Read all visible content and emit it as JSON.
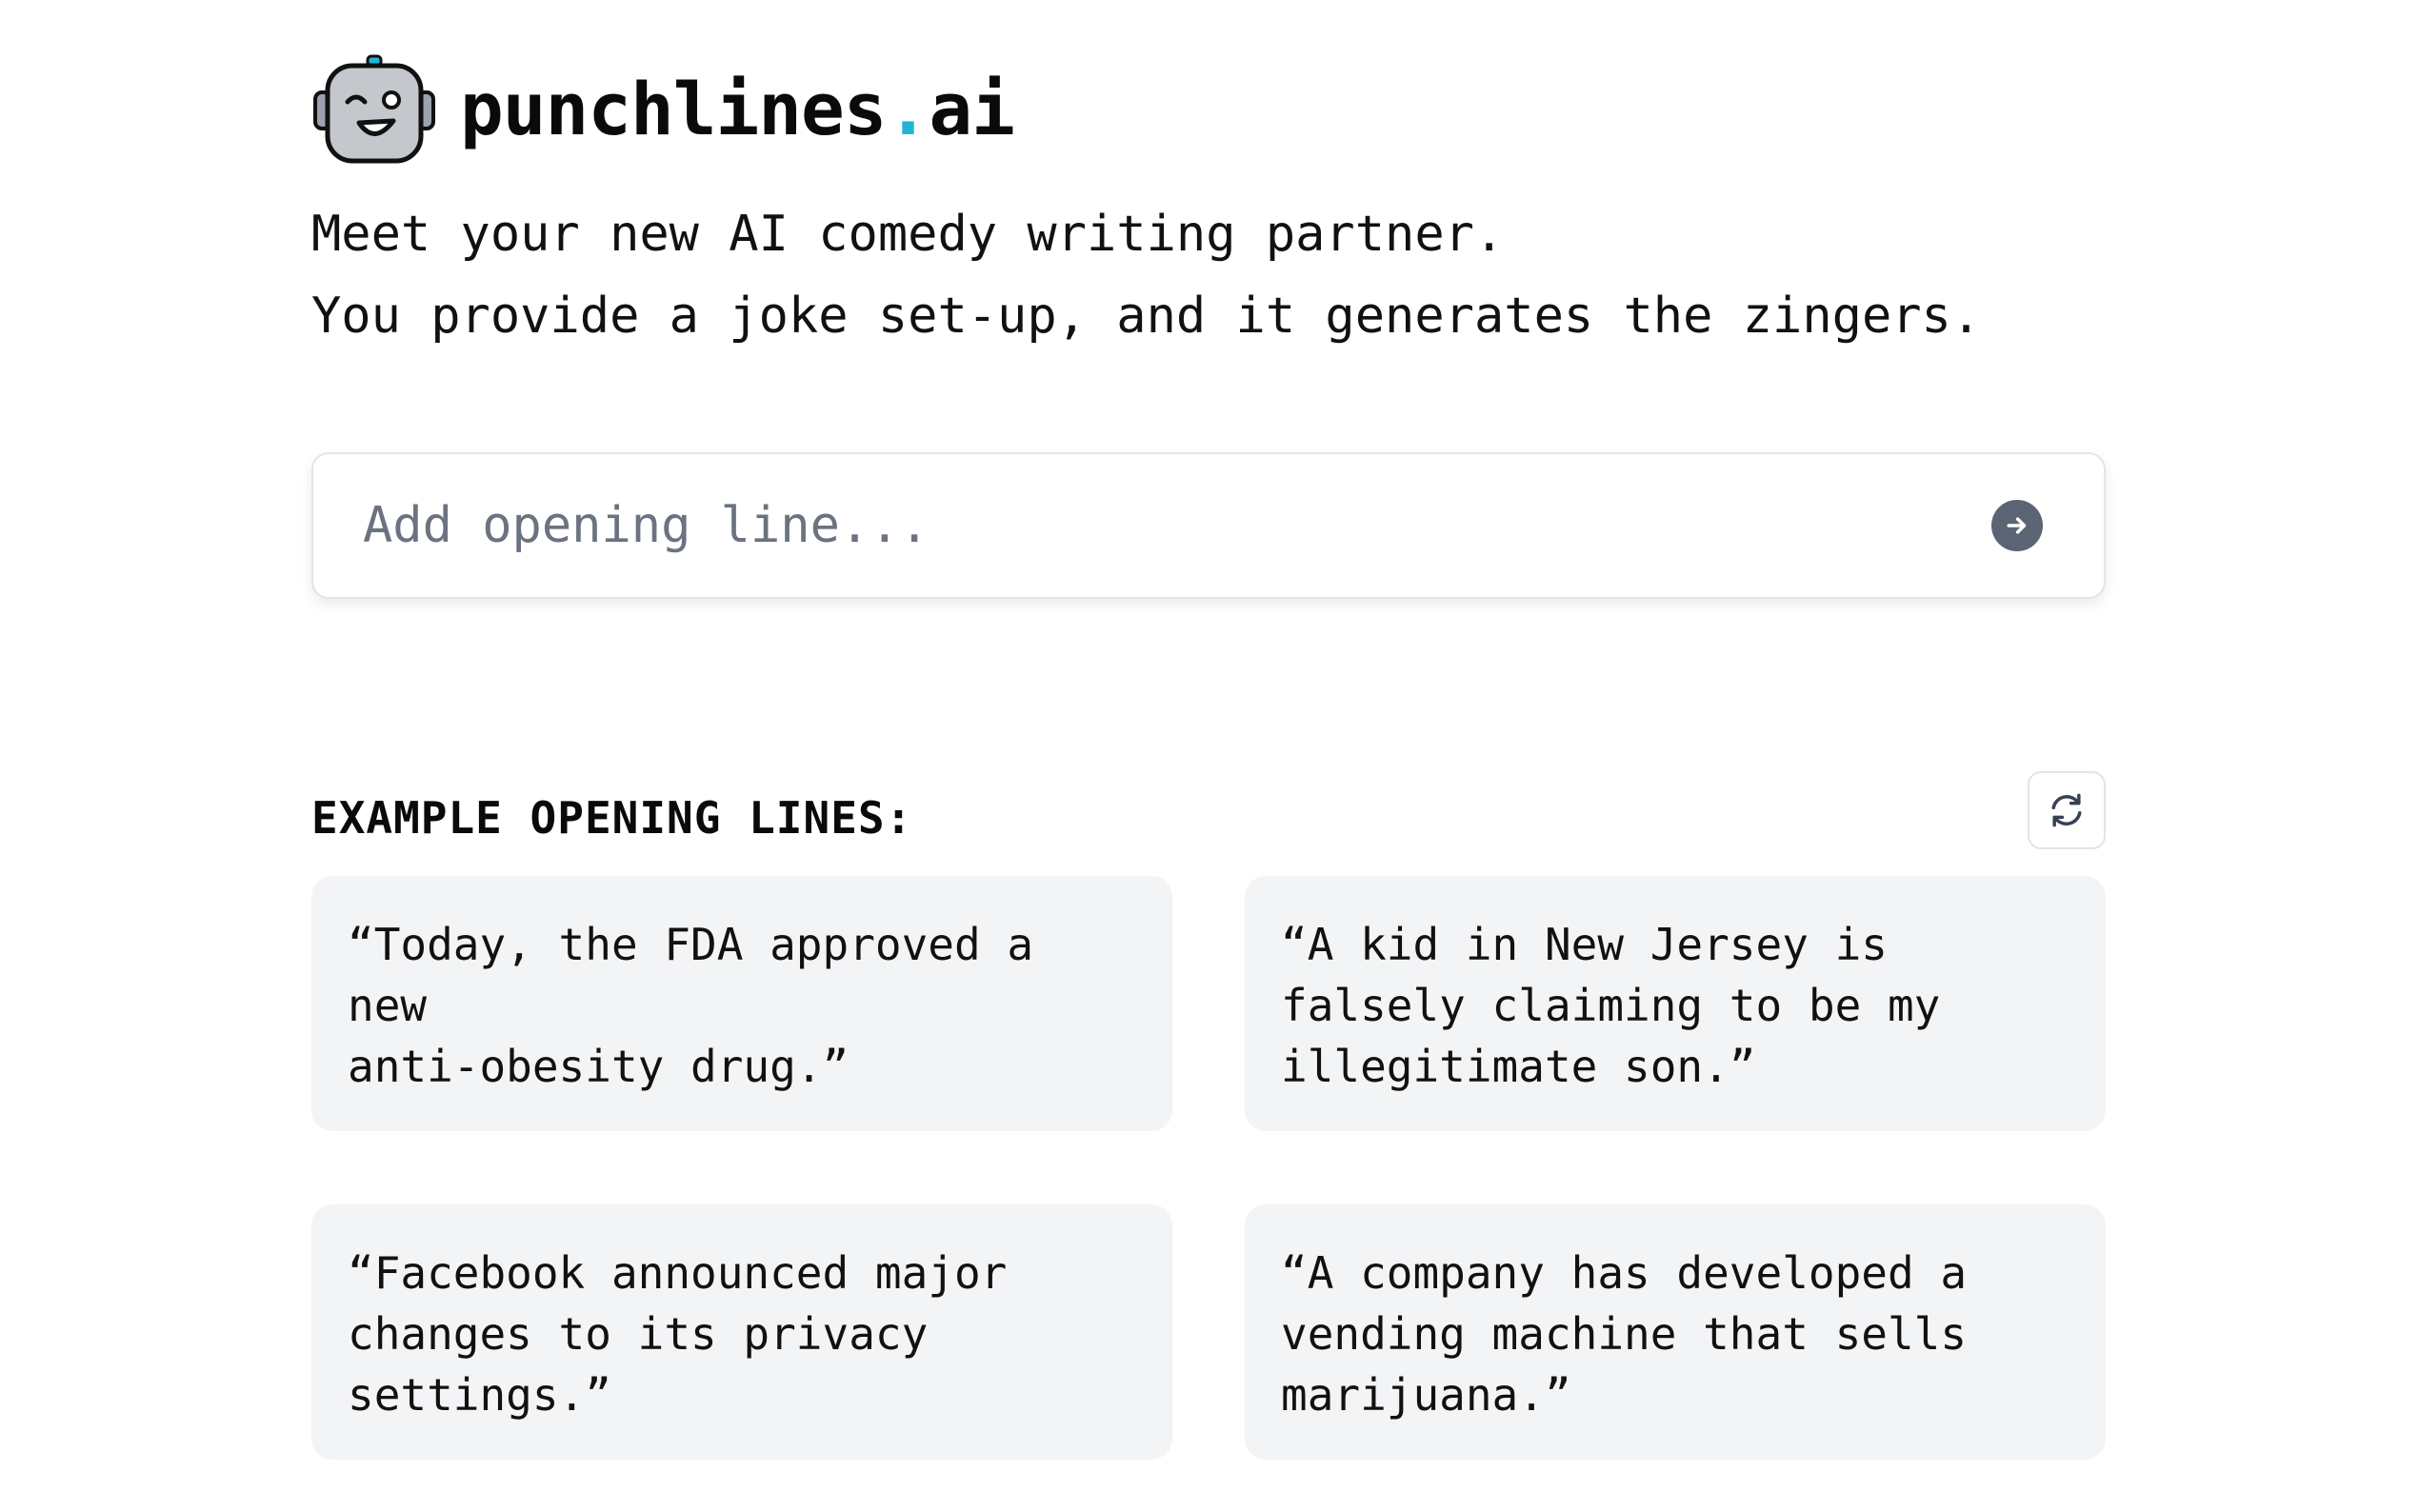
{
  "brand": {
    "name_main": "punchlines",
    "name_dot": ".",
    "name_suffix": "ai",
    "dot_color": "#22b4d4",
    "logo_icon": "robot-face-icon"
  },
  "tagline": {
    "line1": "Meet your new AI comedy writing partner.",
    "line2": "You provide a joke set-up, and it generates the zingers."
  },
  "search": {
    "value": "",
    "placeholder": "Add opening line...",
    "submit_icon": "arrow-right-circle-icon"
  },
  "examples": {
    "title": "EXAMPLE OPENING LINES:",
    "refresh_icon": "refresh-icon",
    "items": [
      {
        "line1": "“Today, the FDA approved a new",
        "line2": "anti-obesity drug.”",
        "line3": ""
      },
      {
        "line1": "“A kid in New Jersey is",
        "line2": "falsely claiming to be my",
        "line3": "illegitimate son.”"
      },
      {
        "line1": "“Facebook announced major",
        "line2": "changes to its privacy",
        "line3": "settings.”"
      },
      {
        "line1": "“A company has developed a",
        "line2": "vending machine that sells",
        "line3": "marijuana.”"
      }
    ]
  }
}
